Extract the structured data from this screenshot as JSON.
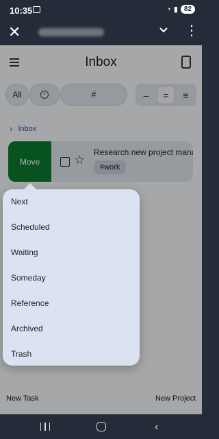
{
  "status_bar": {
    "time": "10:35",
    "battery": "82"
  },
  "header": {
    "title": "Inbox"
  },
  "filters": {
    "all_label": "All",
    "hash_label": "#"
  },
  "view_toggle": {
    "compact": "–",
    "normal": "=",
    "expanded": "≡"
  },
  "breadcrumb": {
    "chevron": "›",
    "label": "Inbox"
  },
  "task": {
    "move_label": "Move",
    "title": "Research new project mana",
    "tag": "#work"
  },
  "move_menu": {
    "items": [
      "Next",
      "Scheduled",
      "Waiting",
      "Someday",
      "Reference",
      "Archived",
      "Trash"
    ]
  },
  "bottom_bar": {
    "new_task": "New Task",
    "new_project": "New Project"
  },
  "icons": {
    "close": "close-icon",
    "check": "check-icon",
    "more": "more-vert-icon",
    "menu": "hamburger-icon",
    "sync": "sync-device-icon",
    "clock": "clock-icon",
    "star": "star-icon"
  },
  "colors": {
    "accent_green": "#0b7a2e",
    "menu_bg": "#dbe3f3",
    "chrome": "#232c38"
  }
}
